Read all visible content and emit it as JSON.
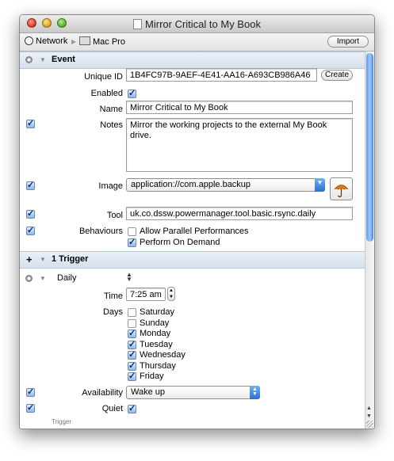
{
  "window": {
    "title": "Mirror Critical to My Book"
  },
  "path": {
    "network": "Network",
    "mac": "Mac Pro",
    "import_label": "Import"
  },
  "event": {
    "header": "Event",
    "unique_id_label": "Unique ID",
    "unique_id": "1B4FC97B-9AEF-4E41-AA16-A693CB986A46",
    "create_label": "Create",
    "enabled_label": "Enabled",
    "name_label": "Name",
    "name": "Mirror Critical to My Book",
    "notes_label": "Notes",
    "notes": "Mirror the working projects to the external My Book drive.",
    "image_label": "Image",
    "image": "application://com.apple.backup",
    "tool_label": "Tool",
    "tool": "uk.co.dssw.powermanager.tool.basic.rsync.daily",
    "behaviours_label": "Behaviours",
    "behaviours": [
      {
        "label": "Allow Parallel Performances",
        "checked": false
      },
      {
        "label": "Perform On Demand",
        "checked": true
      }
    ]
  },
  "trigger": {
    "header": "1 Trigger",
    "plus": "+",
    "type": "Daily",
    "time_label": "Time",
    "time": "7:25 am",
    "days_label": "Days",
    "days": [
      {
        "label": "Saturday",
        "checked": false
      },
      {
        "label": "Sunday",
        "checked": false
      },
      {
        "label": "Monday",
        "checked": true
      },
      {
        "label": "Tuesday",
        "checked": true
      },
      {
        "label": "Wednesday",
        "checked": true
      },
      {
        "label": "Thursday",
        "checked": true
      },
      {
        "label": "Friday",
        "checked": true
      }
    ],
    "availability_label": "Availability",
    "availability": "Wake up",
    "quiet_label": "Quiet",
    "footer": "Trigger"
  },
  "colors": {
    "accent": "#2b6fd2",
    "section_bg": "#dde6f1"
  }
}
